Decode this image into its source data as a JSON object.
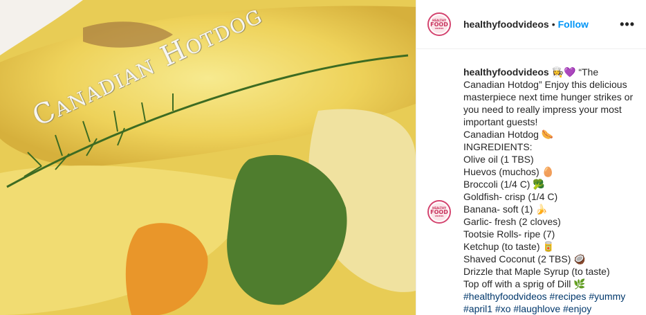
{
  "media": {
    "overlay_text": "Canadian Hotdog"
  },
  "header": {
    "username": "healthyfoodvideos",
    "separator": "•",
    "follow_label": "Follow",
    "more_label": "•••",
    "avatar_text_1": "HEALTHY",
    "avatar_text_2": "FOOD",
    "avatar_text_3": "VIDEOS"
  },
  "caption": {
    "username": "healthyfoodvideos",
    "text": " 👩‍🍳💜 “The Canadian Hotdog” Enjoy this delicious masterpiece next time hunger strikes or you need to really impress your most important guests!\nCanadian Hotdog 🌭\nINGREDIENTS:\nOlive oil (1 TBS)\nHuevos (muchos) 🥚\nBroccoli (1/4 C) 🥦\nGoldfish- crisp (1/4 C)\nBanana- soft (1) 🍌\nGarlic- fresh (2 cloves)\nTootsie Rolls- ripe (7)\nKetchup (to taste) 🥫\nShaved Coconut (2 TBS) 🥥\nDrizzle that Maple Syrup (to taste)\nTop off with a sprig of Dill 🌿",
    "hashtags": "#healthyfoodvideos #recipes #yummy #april1 #xo #laughlove #enjoy"
  }
}
